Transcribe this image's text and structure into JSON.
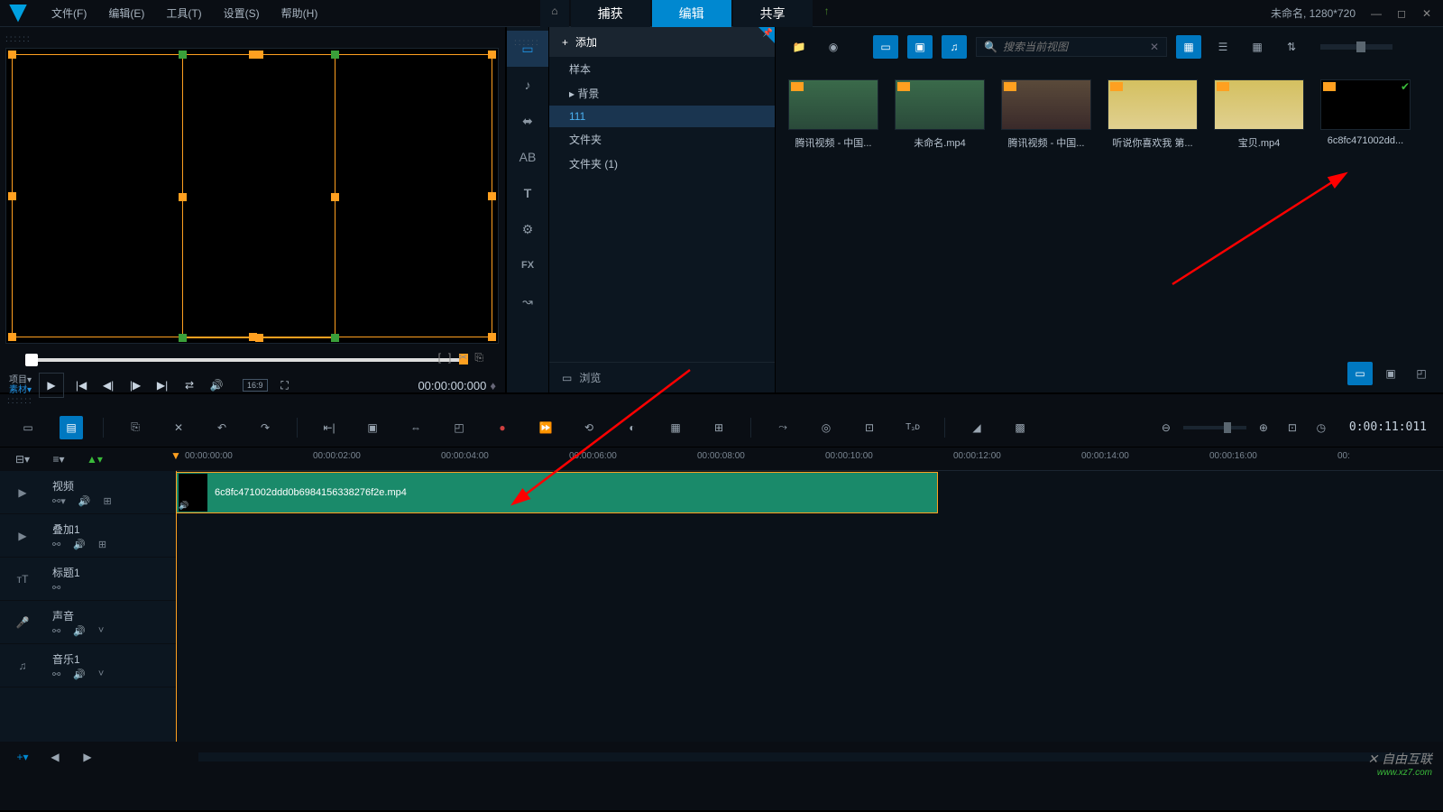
{
  "menu": {
    "file": "文件(F)",
    "edit": "编辑(E)",
    "tool": "工具(T)",
    "settings": "设置(S)",
    "help": "帮助(H)"
  },
  "tabs": {
    "capture": "捕获",
    "edit": "编辑",
    "share": "共享"
  },
  "project_info": "未命名, 1280*720",
  "preview": {
    "label_project": "项目▾",
    "label_material": "素材▾",
    "aspect": "16:9",
    "timecode": "00:00:00:000"
  },
  "library": {
    "add": "添加",
    "tree": {
      "sample": "样本",
      "background": "背景",
      "folder111": "111",
      "folder": "文件夹",
      "folder1": "文件夹 (1)"
    },
    "browse": "浏览",
    "search_placeholder": "搜索当前视图",
    "items": [
      {
        "name": "腾讯视频 - 中国..."
      },
      {
        "name": "未命名.mp4"
      },
      {
        "name": "腾讯视频 - 中国..."
      },
      {
        "name": "听说你喜欢我 第..."
      },
      {
        "name": "宝贝.mp4"
      },
      {
        "name": "6c8fc471002dd..."
      }
    ]
  },
  "timeline": {
    "marks": [
      "00:00:00:00",
      "00:00:02:00",
      "00:00:04:00",
      "00:00:06:00",
      "00:00:08:00",
      "00:00:10:00",
      "00:00:12:00",
      "00:00:14:00",
      "00:00:16:00",
      "00:"
    ],
    "dur": "0:00:11:011",
    "tracks": {
      "video": "视频",
      "overlay": "叠加1",
      "title": "标题1",
      "voice": "声音",
      "music": "音乐1"
    },
    "clip_name": "6c8fc471002ddd0b6984156338276f2e.mp4"
  },
  "watermark": {
    "main": "自由互联",
    "sub": "www.xz7.com"
  }
}
